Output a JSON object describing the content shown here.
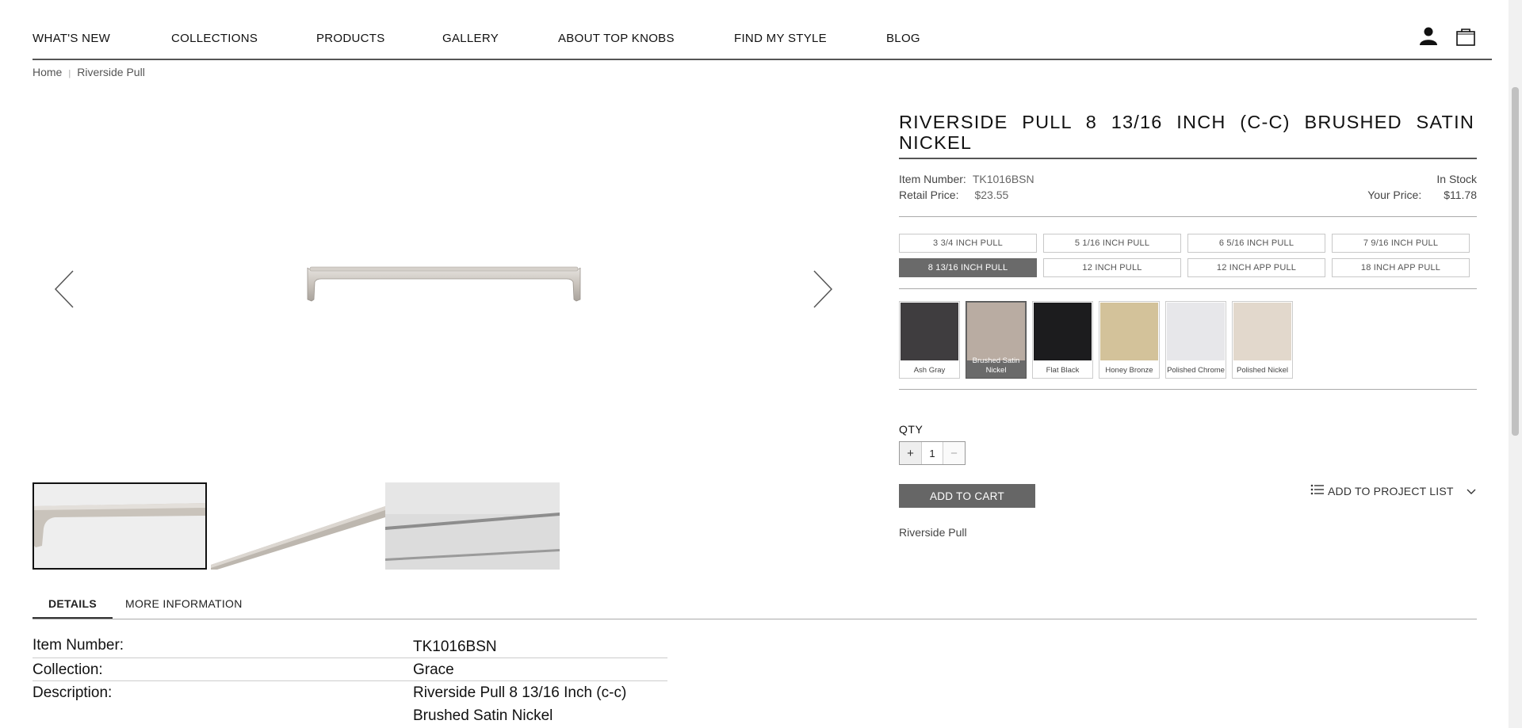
{
  "nav": {
    "items": [
      "WHAT'S NEW",
      "COLLECTIONS",
      "PRODUCTS",
      "GALLERY",
      "ABOUT TOP KNOBS",
      "FIND MY STYLE",
      "BLOG"
    ],
    "account_icon": "user-icon",
    "cart_icon": "shopping-bag-icon"
  },
  "breadcrumb": {
    "home": "Home",
    "current": "Riverside Pull"
  },
  "product": {
    "title": "RIVERSIDE PULL 8 13/16 INCH (C-C) BRUSHED SATIN NICKEL",
    "item_number_label": "Item Number:",
    "item_number": "TK1016BSN",
    "retail_price_label": "Retail Price:",
    "retail_price": "$23.55",
    "stock_status": "In Stock",
    "your_price_label": "Your Price:",
    "your_price": "$11.78",
    "sizes": [
      {
        "label": "3 3/4 INCH PULL",
        "selected": false
      },
      {
        "label": "5 1/16 INCH PULL",
        "selected": false
      },
      {
        "label": "6 5/16 INCH PULL",
        "selected": false
      },
      {
        "label": "7 9/16 INCH PULL",
        "selected": false
      },
      {
        "label": "8 13/16 INCH PULL",
        "selected": true
      },
      {
        "label": "12 INCH PULL",
        "selected": false
      },
      {
        "label": "12 INCH APP PULL",
        "selected": false
      },
      {
        "label": "18 INCH APP PULL",
        "selected": false
      }
    ],
    "finishes": [
      {
        "label": "Ash Gray",
        "color": "#3f3d3f",
        "selected": false
      },
      {
        "label": "Brushed Satin Nickel",
        "color": "#b9aca2",
        "selected": true
      },
      {
        "label": "Flat Black",
        "color": "#1c1c1e",
        "selected": false
      },
      {
        "label": "Honey Bronze",
        "color": "#d3c29a",
        "selected": false
      },
      {
        "label": "Polished Chrome",
        "color": "#e7e7ea",
        "selected": false
      },
      {
        "label": "Polished Nickel",
        "color": "#e2d8cc",
        "selected": false
      }
    ],
    "qty_label": "QTY",
    "qty_value": "1",
    "add_to_cart": "ADD TO CART",
    "add_to_project": "ADD TO PROJECT LIST",
    "collection_link": "Riverside Pull"
  },
  "tabs": [
    "DETAILS",
    "MORE INFORMATION"
  ],
  "details": [
    {
      "key": "Item Number:",
      "value": "TK1016BSN"
    },
    {
      "key": "Collection:",
      "value": "Grace"
    },
    {
      "key": "Description:",
      "value": "Riverside Pull 8 13/16 Inch (c-c)",
      "value2": "Brushed Satin Nickel"
    }
  ]
}
